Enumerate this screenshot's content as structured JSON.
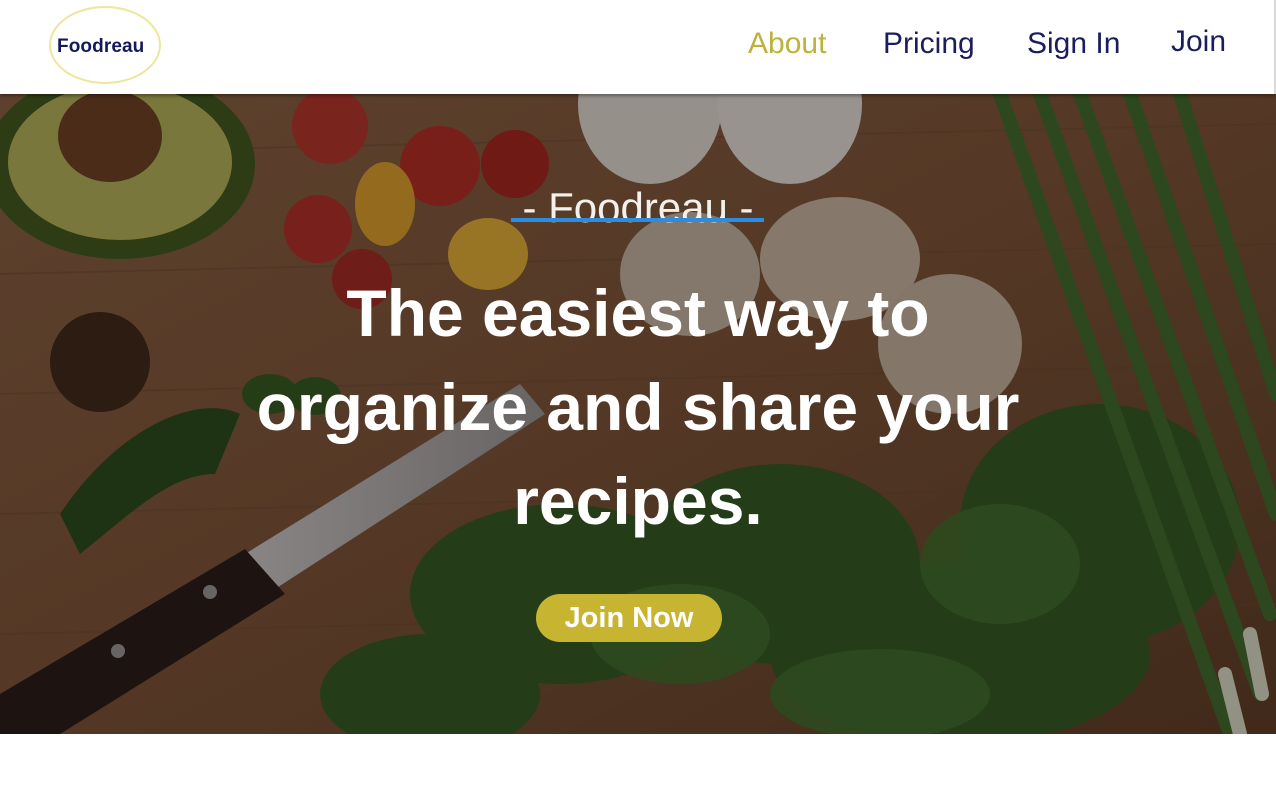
{
  "brand": {
    "logo_text": "Foodreau",
    "logo_ring_color": "#ece79b",
    "text_color": "#14195a"
  },
  "nav": {
    "items": [
      {
        "label": "About",
        "active": true
      },
      {
        "label": "Pricing",
        "active": false
      },
      {
        "label": "Sign In",
        "active": false
      },
      {
        "label": "Join",
        "active": false
      }
    ],
    "active_color": "#bdb23c",
    "link_color": "#1b1e5c"
  },
  "hero": {
    "brand_line": "- Foodreau -",
    "headline": "The easiest way to organize and share your recipes.",
    "cta_label": "Join Now",
    "cta_color": "#c7b531",
    "underline_color": "#2a8de2",
    "background_description_icon": "food-cutting-board-photo"
  }
}
